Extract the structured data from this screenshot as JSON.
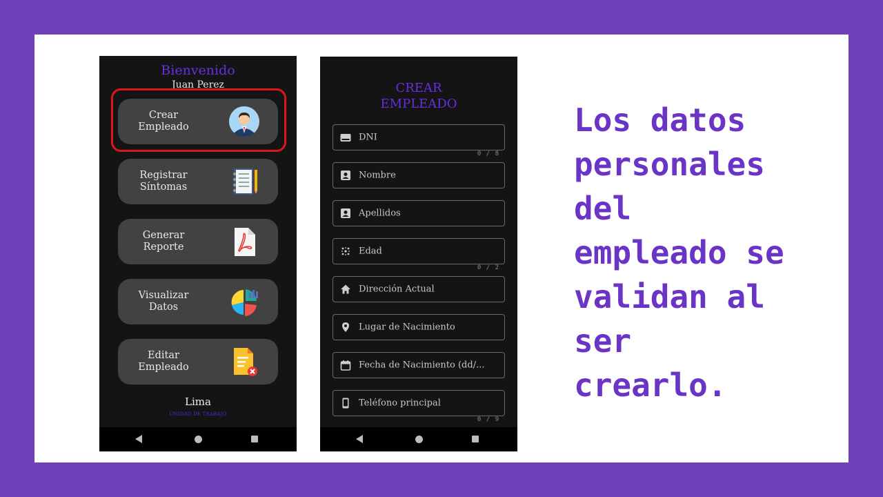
{
  "caption": {
    "lines": [
      "Los datos",
      "personales",
      "del",
      "empleado se",
      "validan al",
      "ser",
      "crearlo."
    ]
  },
  "home_screen": {
    "welcome": "Bienvenido",
    "user_name": "Juan Perez",
    "menu": [
      {
        "line1": "Crear",
        "line2": "Empleado",
        "icon": "employee-avatar-icon"
      },
      {
        "line1": "Registrar",
        "line2": "Síntomas",
        "icon": "notebook-icon"
      },
      {
        "line1": "Generar",
        "line2": "Reporte",
        "icon": "pdf-file-icon"
      },
      {
        "line1": "Visualizar",
        "line2": "Datos",
        "icon": "pie-chart-icon"
      },
      {
        "line1": "Editar",
        "line2": "Empleado",
        "icon": "document-delete-icon"
      }
    ],
    "location": "Lima",
    "location_label": "UNIDAD DE TRABAJO",
    "highlight_color": "#e0141c"
  },
  "form_screen": {
    "title_line1": "CREAR",
    "title_line2": "EMPLEADO",
    "fields": [
      {
        "label": "DNI",
        "icon": "card-icon",
        "counter": "0 / 8"
      },
      {
        "label": "Nombre",
        "icon": "contact-icon",
        "counter": ""
      },
      {
        "label": "Apellidos",
        "icon": "contact-icon",
        "counter": ""
      },
      {
        "label": "Edad",
        "icon": "dots-grid-icon",
        "counter": "0 / 2"
      },
      {
        "label": "Dirección Actual",
        "icon": "home-icon",
        "counter": ""
      },
      {
        "label": "Lugar de Nacimiento",
        "icon": "location-pin-icon",
        "counter": ""
      },
      {
        "label": "Fecha de Nacimiento (dd/...",
        "icon": "calendar-icon",
        "counter": ""
      },
      {
        "label": "Teléfono principal",
        "icon": "phone-icon",
        "counter": "0 / 9"
      }
    ]
  },
  "colors": {
    "background": "#6f42bb",
    "accent": "#6a2ee0",
    "caption": "#6a35c6",
    "phone_bg": "#141414",
    "button_bg": "#424242"
  }
}
